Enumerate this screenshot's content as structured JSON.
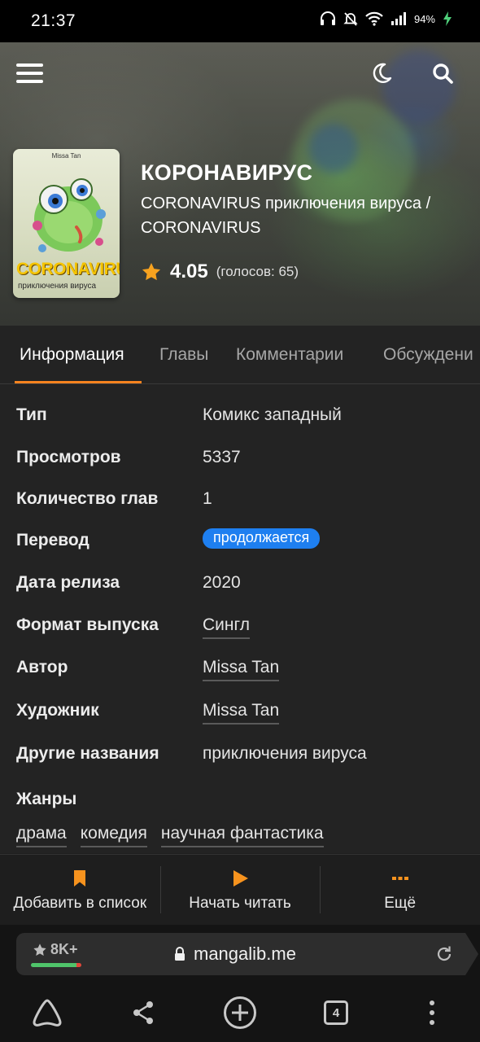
{
  "status_bar": {
    "time": "21:37",
    "battery_percent": "94%",
    "icons": [
      "headphones-icon",
      "notifications-off-icon",
      "wifi-icon",
      "signal-icon",
      "battery-charging-icon"
    ]
  },
  "header": {
    "icons": [
      "menu-icon",
      "moon-icon",
      "search-icon"
    ]
  },
  "cover": {
    "author_mini": "Missa Tan",
    "title": "CORONAVIRUS",
    "subtitle": "приключения вируса"
  },
  "manga": {
    "title": "КОРОНАВИРУС",
    "alt_title": "CORONAVIRUS приключения вируса / CORONAVIRUS",
    "rating": "4.05",
    "votes": "(голосов: 65)"
  },
  "tabs": {
    "items": [
      {
        "label": "Информация",
        "active": true
      },
      {
        "label": "Главы",
        "active": false
      },
      {
        "label": "Комментарии",
        "active": false
      },
      {
        "label": "Обсуждени",
        "active": false
      }
    ]
  },
  "info": {
    "type_label": "Тип",
    "type_value": "Комикс западный",
    "views_label": "Просмотров",
    "views_value": "5337",
    "chapters_label": "Количество глав",
    "chapters_value": "1",
    "translation_label": "Перевод",
    "translation_value": "продолжается",
    "release_label": "Дата релиза",
    "release_value": "2020",
    "format_label": "Формат выпуска",
    "format_value": "Сингл",
    "author_label": "Автор",
    "author_value": "Missa Tan",
    "artist_label": "Художник",
    "artist_value": "Missa Tan",
    "other_names_label": "Другие названия",
    "other_names_value": "приключения вируса",
    "genres_label": "Жанры",
    "genres": [
      "драма",
      "комедия",
      "научная фантастика"
    ]
  },
  "actions": {
    "add_to_list": "Добавить в список",
    "start_reading": "Начать читать",
    "more": "Ещё",
    "accent_color": "#f7931e"
  },
  "browser": {
    "reviews": "8K+",
    "domain": "mangalib.me",
    "tabs_count": "4"
  },
  "colors": {
    "accent": "#f7831f",
    "status_badge": "#1e7ff0",
    "background": "#232323"
  }
}
